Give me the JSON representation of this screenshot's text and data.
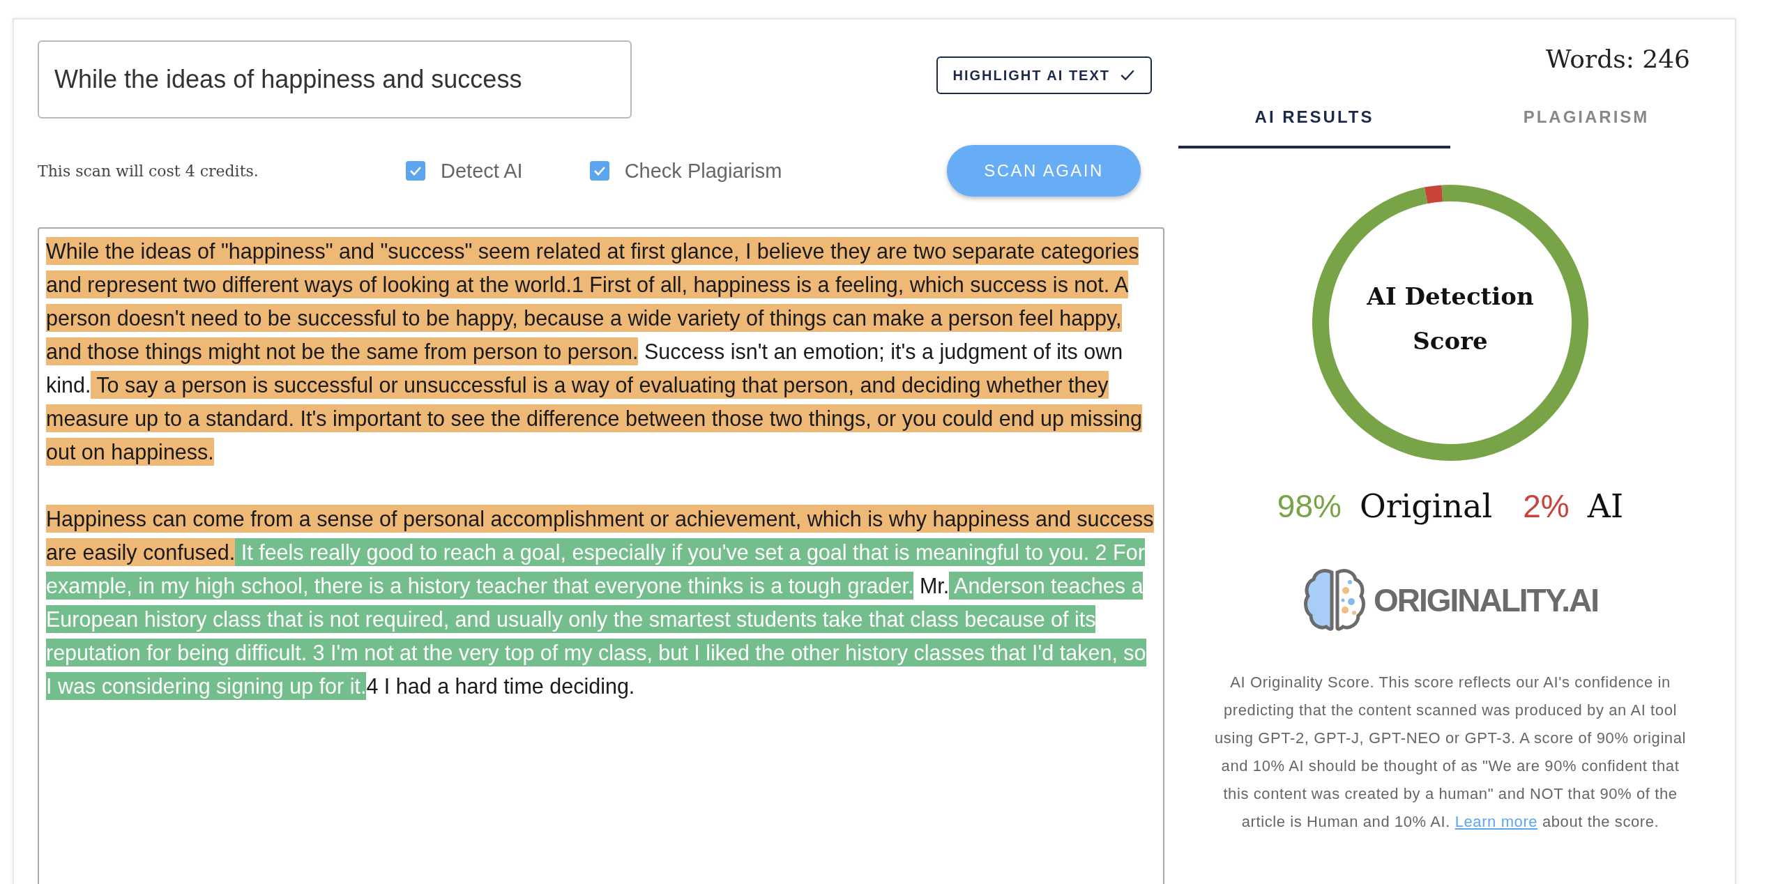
{
  "scan_input": {
    "value": "While the ideas of happiness and success"
  },
  "highlight_button": {
    "label": "HIGHLIGHT AI TEXT",
    "checked": true
  },
  "cost_note": "This scan will cost 4 credits.",
  "options": [
    {
      "label": "Detect AI",
      "checked": true
    },
    {
      "label": "Check Plagiarism",
      "checked": true
    }
  ],
  "scan_button": {
    "label": "SCAN AGAIN"
  },
  "document": {
    "paragraphs": [
      {
        "segments": [
          {
            "text": "While the ideas of \"happiness\" and \"success\" seem related at first glance, I believe they are two separate categories and represent two different ways of looking at the world.1 First of all, happiness is a feeling, which success is not. A person doesn't need to be successful to be happy, because a wide variety of things can make a person feel happy, and those things might not be the same from person to person.",
            "color": "#eeb877"
          },
          {
            "text": " Success isn't an emotion; it's a judgment of its own kind."
          },
          {
            "text": " To say a person is successful or unsuccessful is a way of evaluating that person, and deciding whether they measure up to a standard. It's important to see the difference between those two things, or you could end up missing out on happiness.",
            "color": "#eeb877"
          }
        ]
      },
      {
        "segments": [
          {
            "text": "Happiness can come from a sense of personal accomplishment or achievement, which is why happiness and success are easily confused.",
            "color": "#eeb877"
          },
          {
            "text": " It feels really good to reach a goal, especially if you've set a goal that is meaningful to you. 2 For example, in my high school, there is a history teacher that everyone thinks is a tough grader.",
            "color": "#74bd8c"
          },
          {
            "text": " Mr."
          },
          {
            "text": " Anderson teaches a European history class that is not required, and usually only the smartest students take that class because of its reputation for being difficult. 3 I'm not at the very top of my class, but I liked the other history classes that I'd taken, so I was considering signing up for it.",
            "color": "#74bd8c"
          },
          {
            "text": "4 I had a hard time deciding."
          }
        ]
      }
    ]
  },
  "word_count": "Words: 246",
  "tabs": [
    {
      "label": "AI RESULTS",
      "selected": true
    },
    {
      "label": "PLAGIARISM",
      "selected": false
    }
  ],
  "score": {
    "title": "AI Detection Score",
    "chart_data": {
      "type": "donut",
      "categories": [
        "Original",
        "AI"
      ],
      "values": [
        98,
        2
      ]
    },
    "legend": [
      {
        "value": "98%",
        "color": "#78a347"
      },
      {
        "value": "2%",
        "color": "#c8433a"
      }
    ]
  },
  "logo": {
    "text": "ORIGINALITY.AI"
  },
  "description": {
    "text": "AI Originality Score. This score reflects our AI's confidence in predicting that the content scanned was produced by an AI tool using GPT-2, GPT-J, GPT-NEO or GPT-3. A score of 90% original and 10% AI should be thought of as \"We are 90% confident that this content was created by a human\" and NOT that 90% of the article is Human and 10% AI.",
    "link": "Learn more",
    "after": " about the score."
  }
}
